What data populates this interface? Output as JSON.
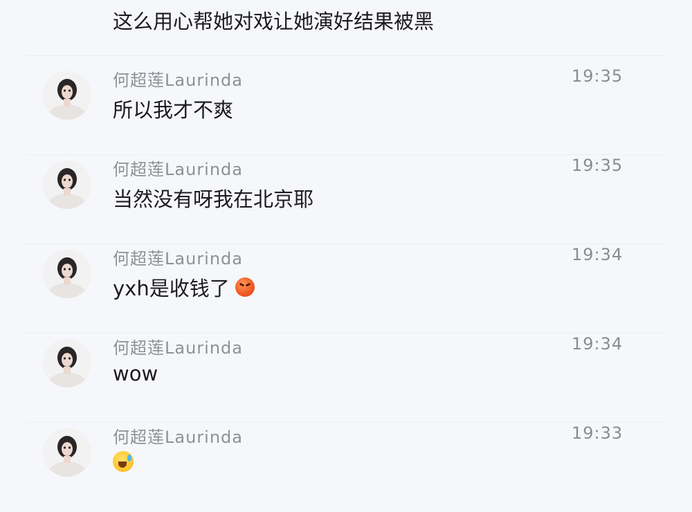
{
  "messages": [
    {
      "sender": "",
      "time": "",
      "text": "这么用心帮她对戏让她演好结果被黑",
      "emoji": ""
    },
    {
      "sender": "何超莲Laurinda",
      "time": "19:35",
      "text": "所以我才不爽",
      "emoji": ""
    },
    {
      "sender": "何超莲Laurinda",
      "time": "19:35",
      "text": "当然没有呀我在北京耶",
      "emoji": ""
    },
    {
      "sender": "何超莲Laurinda",
      "time": "19:34",
      "text": "yxh是收钱了",
      "emoji": "angry-face-emoji"
    },
    {
      "sender": "何超莲Laurinda",
      "time": "19:34",
      "text": "wow",
      "emoji": ""
    },
    {
      "sender": "何超莲Laurinda",
      "time": "19:33",
      "text": "",
      "emoji": "laughing-tears-emoji"
    }
  ],
  "colors": {
    "background": "#f6f7fb",
    "sender_name": "#8e9096",
    "message_text": "#1c1c1e"
  }
}
